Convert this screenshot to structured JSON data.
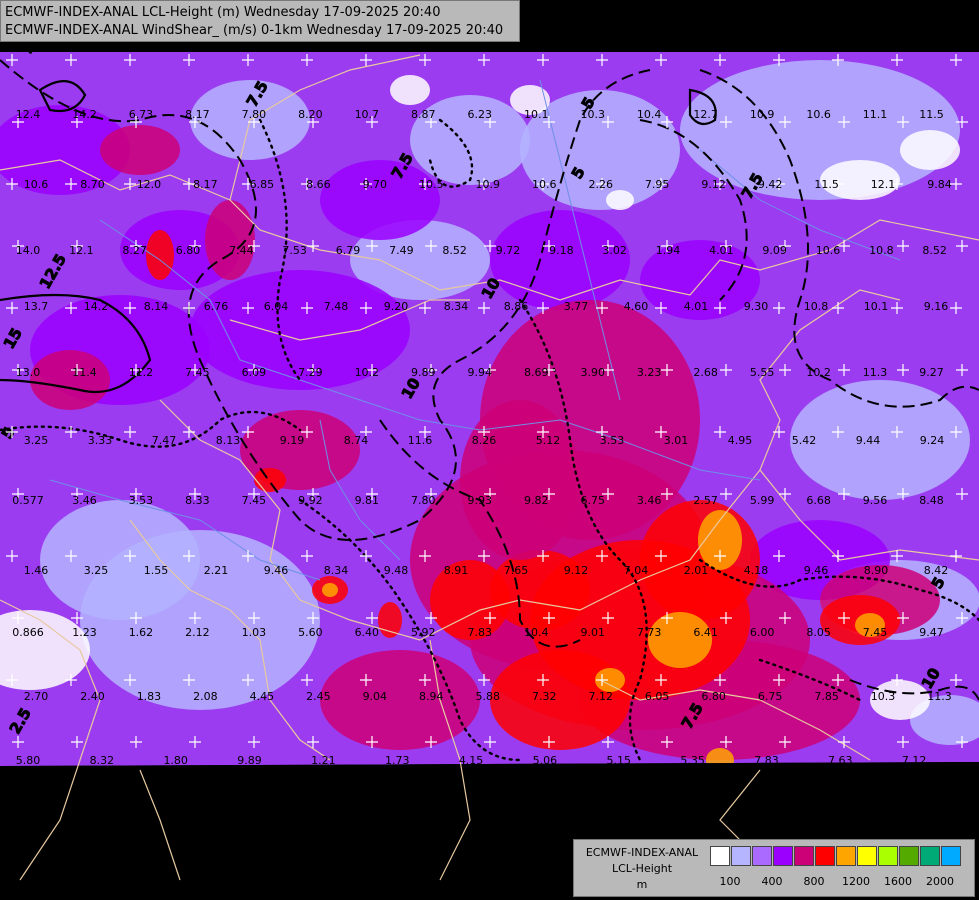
{
  "title": {
    "line1": "ECMWF-INDEX-ANAL LCL-Height (m) Wednesday 17-09-2025 20:40",
    "line2": "ECMWF-INDEX-ANAL WindShear_ (m/s) 0-1km Wednesday 17-09-2025 20:40"
  },
  "legend": {
    "model": "ECMWF-INDEX-ANAL",
    "field": "LCL-Height",
    "unit": "m",
    "colors": [
      "#ffffff",
      "#b4b4ff",
      "#aa6aff",
      "#9b00ff",
      "#cc0077",
      "#ff0000",
      "#ffa500",
      "#ffff00",
      "#aaff00",
      "#55aa00",
      "#00aa77",
      "#00aaff"
    ],
    "tick_labels": [
      "100",
      "400",
      "800",
      "1200",
      "1600",
      "2000"
    ]
  },
  "shear_contour_labels": [
    "10",
    "12.5",
    "7.5",
    "5",
    "2.5",
    "15",
    "7.5",
    "10",
    "10",
    "7.5",
    "5",
    "7.5",
    "10",
    "5",
    "5"
  ],
  "station_values": [
    "12.4",
    "14.2",
    "6.73",
    "8.17",
    "7.80",
    "8.20",
    "10.7",
    "8.87",
    "6.23",
    "10.1",
    "10.3",
    "10.4",
    "12.7",
    "10.9",
    "10.6",
    "11.1",
    "11.5",
    "10.6",
    "8.70",
    "12.0",
    "8.17",
    "6.85",
    "8.66",
    "9.70",
    "10.5",
    "10.9",
    "10.6",
    "2.26",
    "7.95",
    "9.12",
    "9.42",
    "11.5",
    "12.1",
    "9.84",
    "14.0",
    "12.1",
    "8.27",
    "6.80",
    "7.44",
    "7.53",
    "6.79",
    "7.49",
    "8.52",
    "9.72",
    "9.18",
    "3.02",
    "1.94",
    "4.01",
    "9.09",
    "10.6",
    "10.8",
    "8.52",
    "13.7",
    "14.2",
    "8.14",
    "6.76",
    "6.04",
    "7.48",
    "9.20",
    "8.34",
    "8.86",
    "3.77",
    "4.60",
    "4.01",
    "9.30",
    "10.8",
    "10.1",
    "9.16",
    "13.0",
    "11.4",
    "11.2",
    "7.45",
    "6.09",
    "7.29",
    "10.2",
    "9.89",
    "9.94",
    "8.69",
    "3.90",
    "3.23",
    "2.68",
    "5.55",
    "10.2",
    "11.3",
    "9.27",
    "3.25",
    "3.33",
    "7.47",
    "8.13",
    "9.19",
    "8.74",
    "11.6",
    "8.26",
    "5.12",
    "3.53",
    "3.01",
    "4.95",
    "5.42",
    "9.44",
    "9.24",
    "0.577",
    "3.46",
    "3.53",
    "8.33",
    "7.45",
    "9.92",
    "9.81",
    "7.80",
    "9.93",
    "9.82",
    "6.75",
    "3.46",
    "2.57",
    "5.99",
    "6.68",
    "9.56",
    "8.48",
    "1.46",
    "3.25",
    "1.55",
    "2.21",
    "9.46",
    "8.34",
    "9.48",
    "8.91",
    "7.65",
    "9.12",
    "7.04",
    "2.01",
    "4.18",
    "9.46",
    "8.90",
    "8.42",
    "0.866",
    "1.23",
    "1.62",
    "2.12",
    "1.03",
    "5.60",
    "6.40",
    "5.92",
    "7.83",
    "10.4",
    "9.01",
    "7.73",
    "6.41",
    "6.00",
    "8.05",
    "7.45",
    "9.47",
    "2.70",
    "2.40",
    "1.83",
    "2.08",
    "4.45",
    "2.45",
    "9.04",
    "8.94",
    "5.88",
    "7.32",
    "7.12",
    "6.05",
    "6.80",
    "6.75",
    "7.85",
    "10.3",
    "11.3",
    "5.80",
    "8.32",
    "1.80",
    "9.89",
    "1.21",
    "1.73",
    "4.15",
    "5.06",
    "5.15",
    "5.35",
    "7.83",
    "7.63",
    "7.12"
  ]
}
